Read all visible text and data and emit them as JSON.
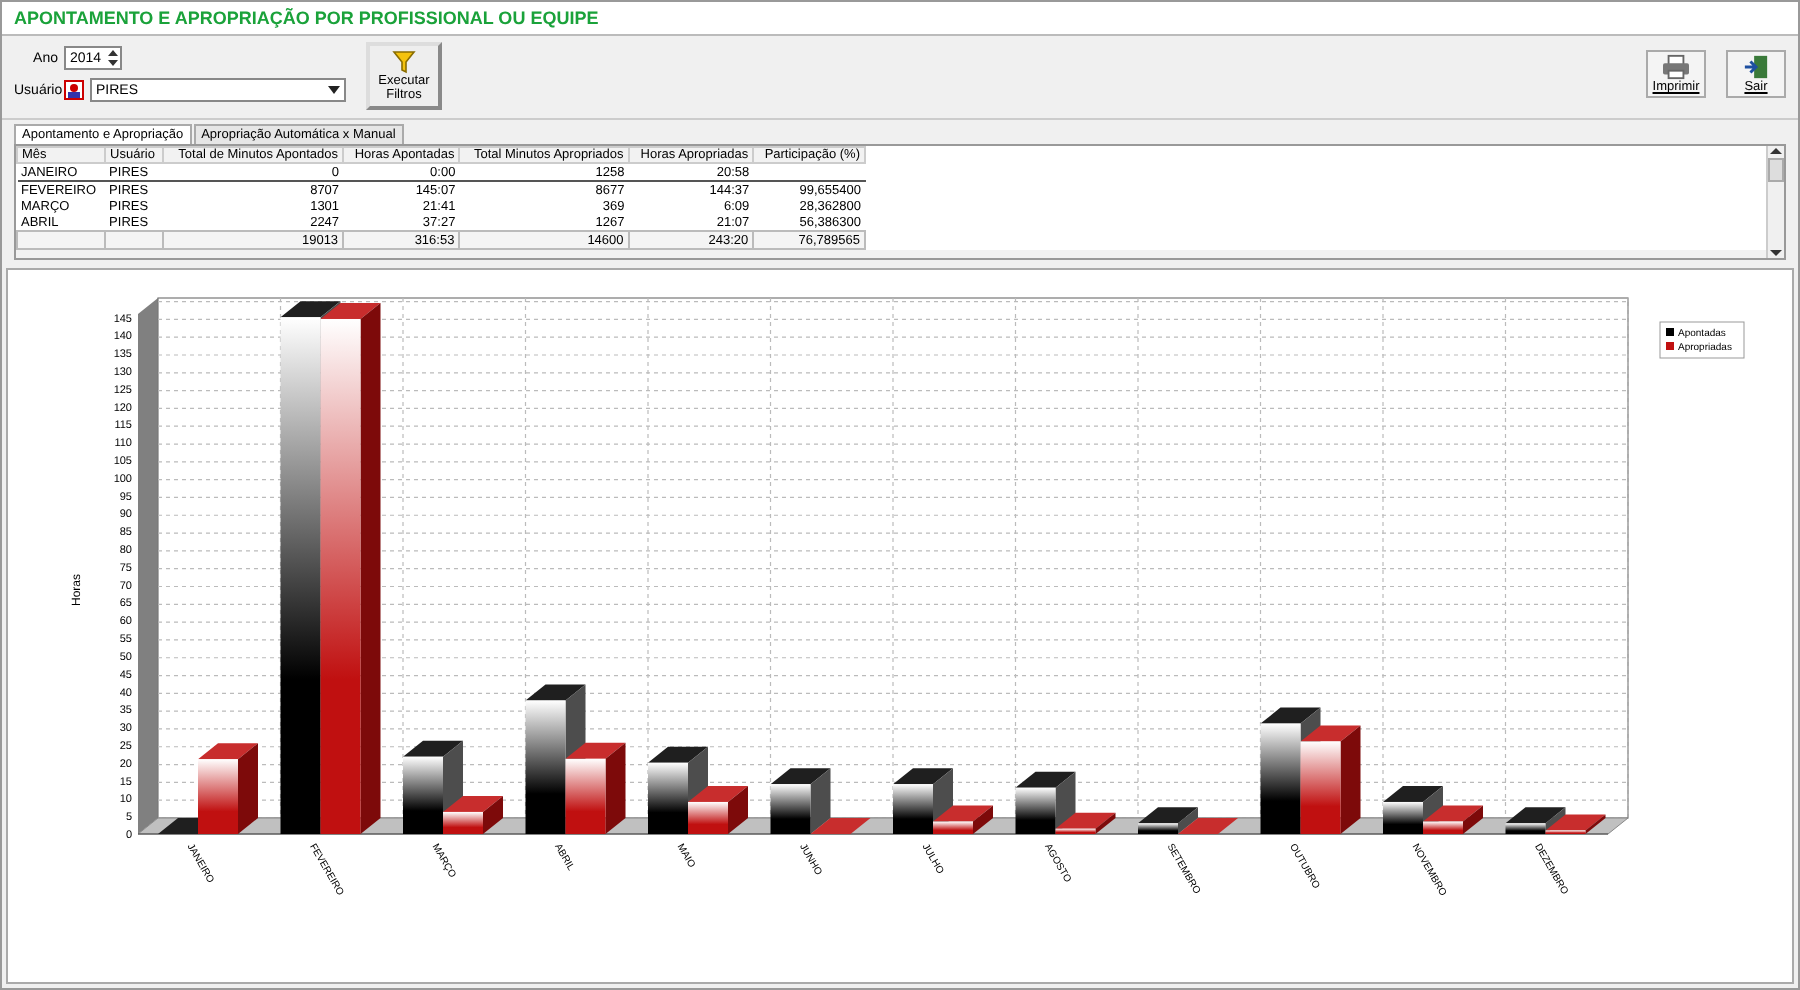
{
  "window": {
    "title": "APONTAMENTO E APROPRIAÇÃO POR PROFISSIONAL OU EQUIPE"
  },
  "filters": {
    "year_label": "Ano",
    "year": "2014",
    "user_label": "Usuário",
    "user": "PIRES",
    "run_button": "Executar Filtros"
  },
  "actions": [
    "Imprimir",
    "Sair"
  ],
  "tabs": [
    {
      "label": "Apontamento e Apropriação",
      "selected": true
    },
    {
      "label": "Apropriação Automática x Manual",
      "selected": false
    }
  ],
  "table": {
    "columns": [
      "Mês",
      "Usuário",
      "Total de Minutos Apontados",
      "Horas Apontadas",
      "Total Minutos Apropriados",
      "Horas Apropriadas",
      "Participação (%)"
    ],
    "rows": [
      [
        "JANEIRO",
        "PIRES",
        "0",
        "0:00",
        "1258",
        "20:58",
        ""
      ],
      [
        "FEVEREIRO",
        "PIRES",
        "8707",
        "145:07",
        "8677",
        "144:37",
        "99,655400"
      ],
      [
        "MARÇO",
        "PIRES",
        "1301",
        "21:41",
        "369",
        "6:09",
        "28,362800"
      ],
      [
        "ABRIL",
        "PIRES",
        "2247",
        "37:27",
        "1267",
        "21:07",
        "56,386300"
      ]
    ],
    "totals": [
      "19013",
      "316:53",
      "14600",
      "243:20",
      "76,789565"
    ]
  },
  "chart_data": {
    "type": "bar",
    "ylabel": "Horas",
    "grid": true,
    "legend": true,
    "categories": [
      "JANEIRO",
      "FEVEREIRO",
      "MARÇO",
      "ABRIL",
      "MAIO",
      "JUNHO",
      "JULHO",
      "AGOSTO",
      "SETEMBRO",
      "OUTUBRO",
      "NOVEMBRO",
      "DEZEMBRO"
    ],
    "series": [
      {
        "name": "Apontadas",
        "color": "#000000",
        "values": [
          0,
          145.1,
          21.7,
          37.5,
          20,
          14,
          14,
          13,
          3,
          31,
          9,
          3
        ]
      },
      {
        "name": "Apropriadas",
        "color": "#c01010",
        "values": [
          21,
          144.6,
          6.2,
          21.1,
          9,
          0,
          3.5,
          1.5,
          0,
          26,
          3.5,
          1
        ]
      }
    ],
    "ylim": [
      0,
      146
    ],
    "yticks": [
      0,
      5,
      10,
      15,
      20,
      25,
      30,
      35,
      40,
      45,
      50,
      55,
      60,
      65,
      70,
      75,
      80,
      85,
      90,
      95,
      100,
      105,
      110,
      115,
      120,
      125,
      130,
      135,
      140,
      145
    ]
  }
}
